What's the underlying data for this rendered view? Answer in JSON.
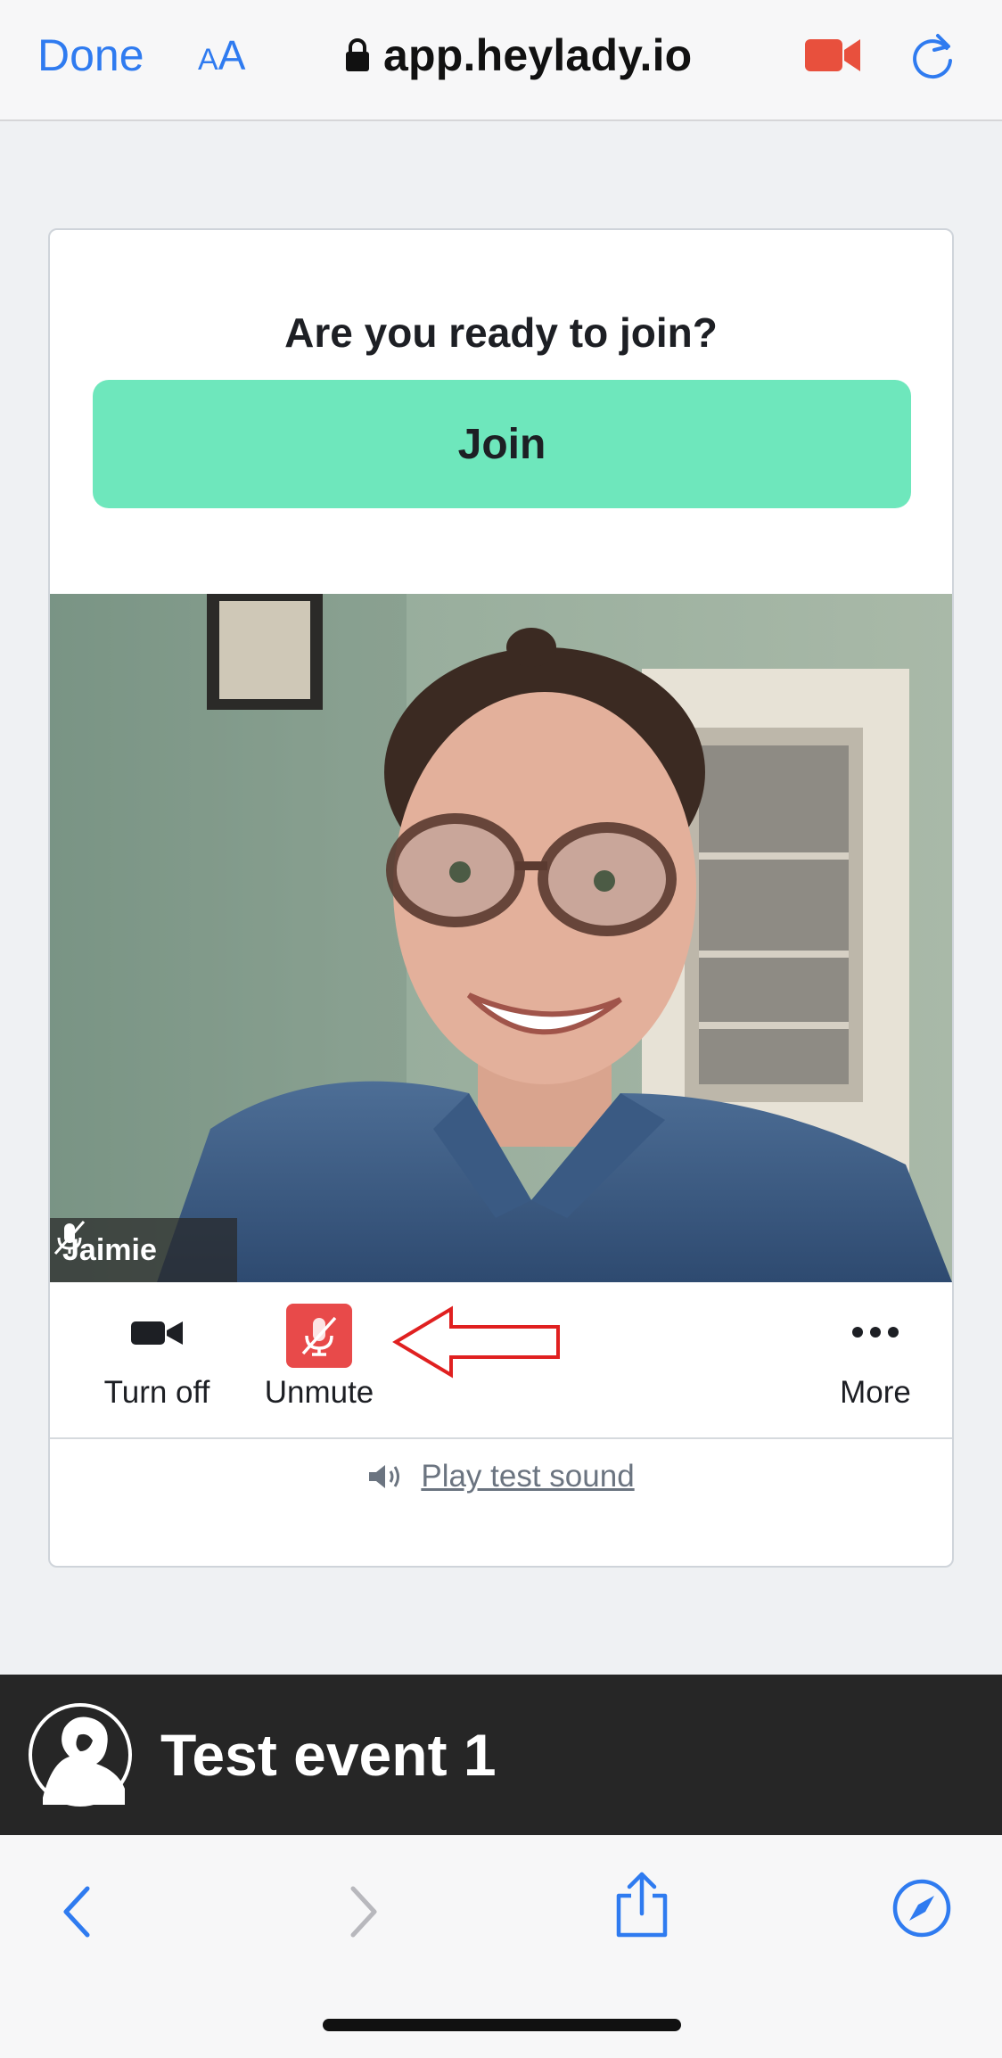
{
  "browser": {
    "done_label": "Done",
    "aa_small": "A",
    "aa_big": "A",
    "url": "app.heylady.io",
    "accent_color": "#2f7bf0"
  },
  "prejoin": {
    "heading": "Are you ready to join?",
    "join_label": "Join",
    "join_color": "#6ee7bc"
  },
  "video": {
    "participant_name": "Jaimie"
  },
  "controls": {
    "camera_label": "Turn off",
    "mute_label": "Unmute",
    "more_label": "More",
    "mute_color": "#e84a4a"
  },
  "test_sound": {
    "label": "Play test sound"
  },
  "event": {
    "title": "Test event 1"
  },
  "icons": {
    "lock": "lock-icon",
    "camera_indicator": "video-camera-icon",
    "reload": "reload-icon",
    "back": "chevron-left-icon",
    "forward": "chevron-right-icon",
    "share": "share-icon",
    "compass": "compass-icon"
  }
}
